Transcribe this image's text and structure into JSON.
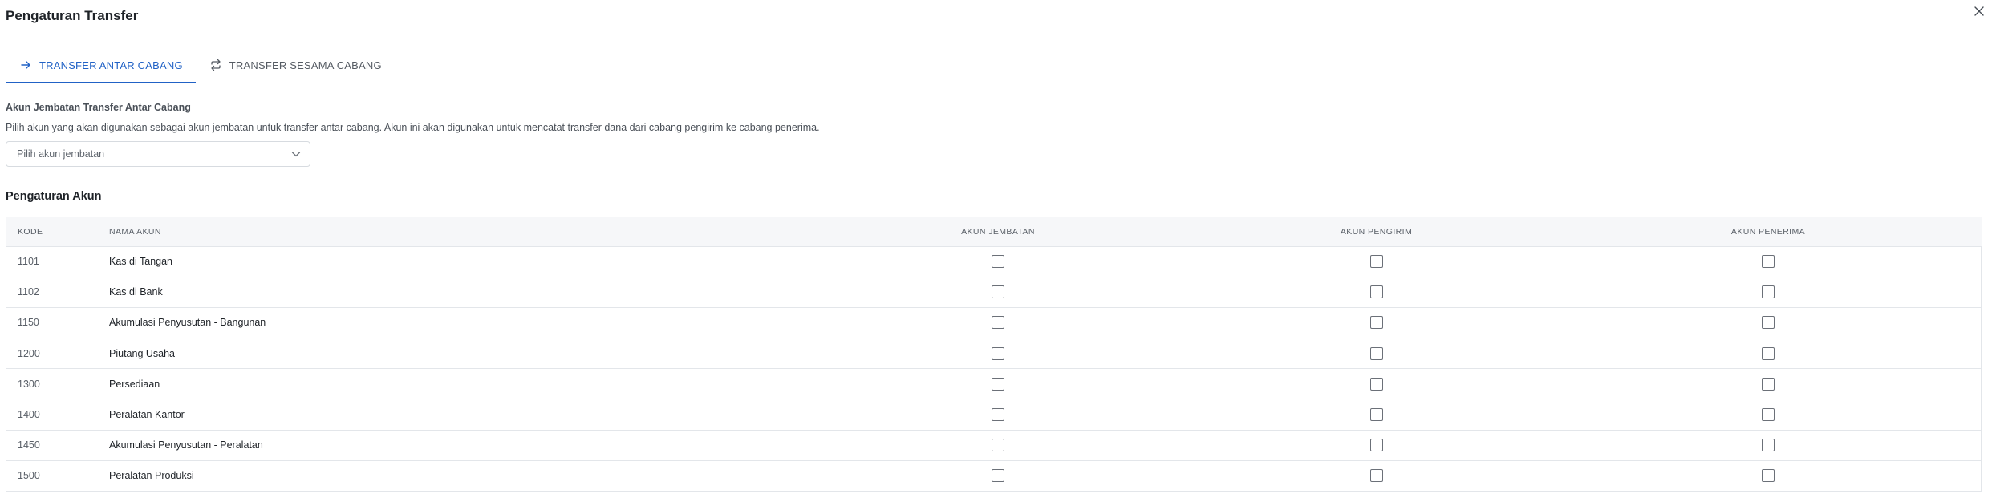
{
  "dialog": {
    "title": "Pengaturan Transfer"
  },
  "tabs": [
    {
      "label": "TRANSFER ANTAR CABANG",
      "icon": "arrow-right-icon",
      "active": true
    },
    {
      "label": "TRANSFER SESAMA CABANG",
      "icon": "repeat-icon",
      "active": false
    }
  ],
  "bridge": {
    "label": "Akun Jembatan Transfer Antar Cabang",
    "description": "Pilih akun yang akan digunakan sebagai akun jembatan untuk transfer antar cabang. Akun ini akan digunakan untuk mencatat transfer dana dari cabang pengirim ke cabang penerima.",
    "placeholder": "Pilih akun jembatan"
  },
  "accounts": {
    "heading": "Pengaturan Akun",
    "columns": [
      "KODE",
      "NAMA AKUN",
      "AKUN JEMBATAN",
      "AKUN PENGIRIM",
      "AKUN PENERIMA"
    ],
    "rows": [
      {
        "kode": "1101",
        "nama": "Kas di Tangan"
      },
      {
        "kode": "1102",
        "nama": "Kas di Bank"
      },
      {
        "kode": "1150",
        "nama": "Akumulasi Penyusutan - Bangunan"
      },
      {
        "kode": "1200",
        "nama": "Piutang Usaha"
      },
      {
        "kode": "1300",
        "nama": "Persediaan"
      },
      {
        "kode": "1400",
        "nama": "Peralatan Kantor"
      },
      {
        "kode": "1450",
        "nama": "Akumulasi Penyusutan - Peralatan"
      },
      {
        "kode": "1500",
        "nama": "Peralatan Produksi"
      }
    ]
  },
  "colors": {
    "accent": "#2162c6",
    "border": "#e3e6ea",
    "header_bg": "#f6f7f9"
  }
}
